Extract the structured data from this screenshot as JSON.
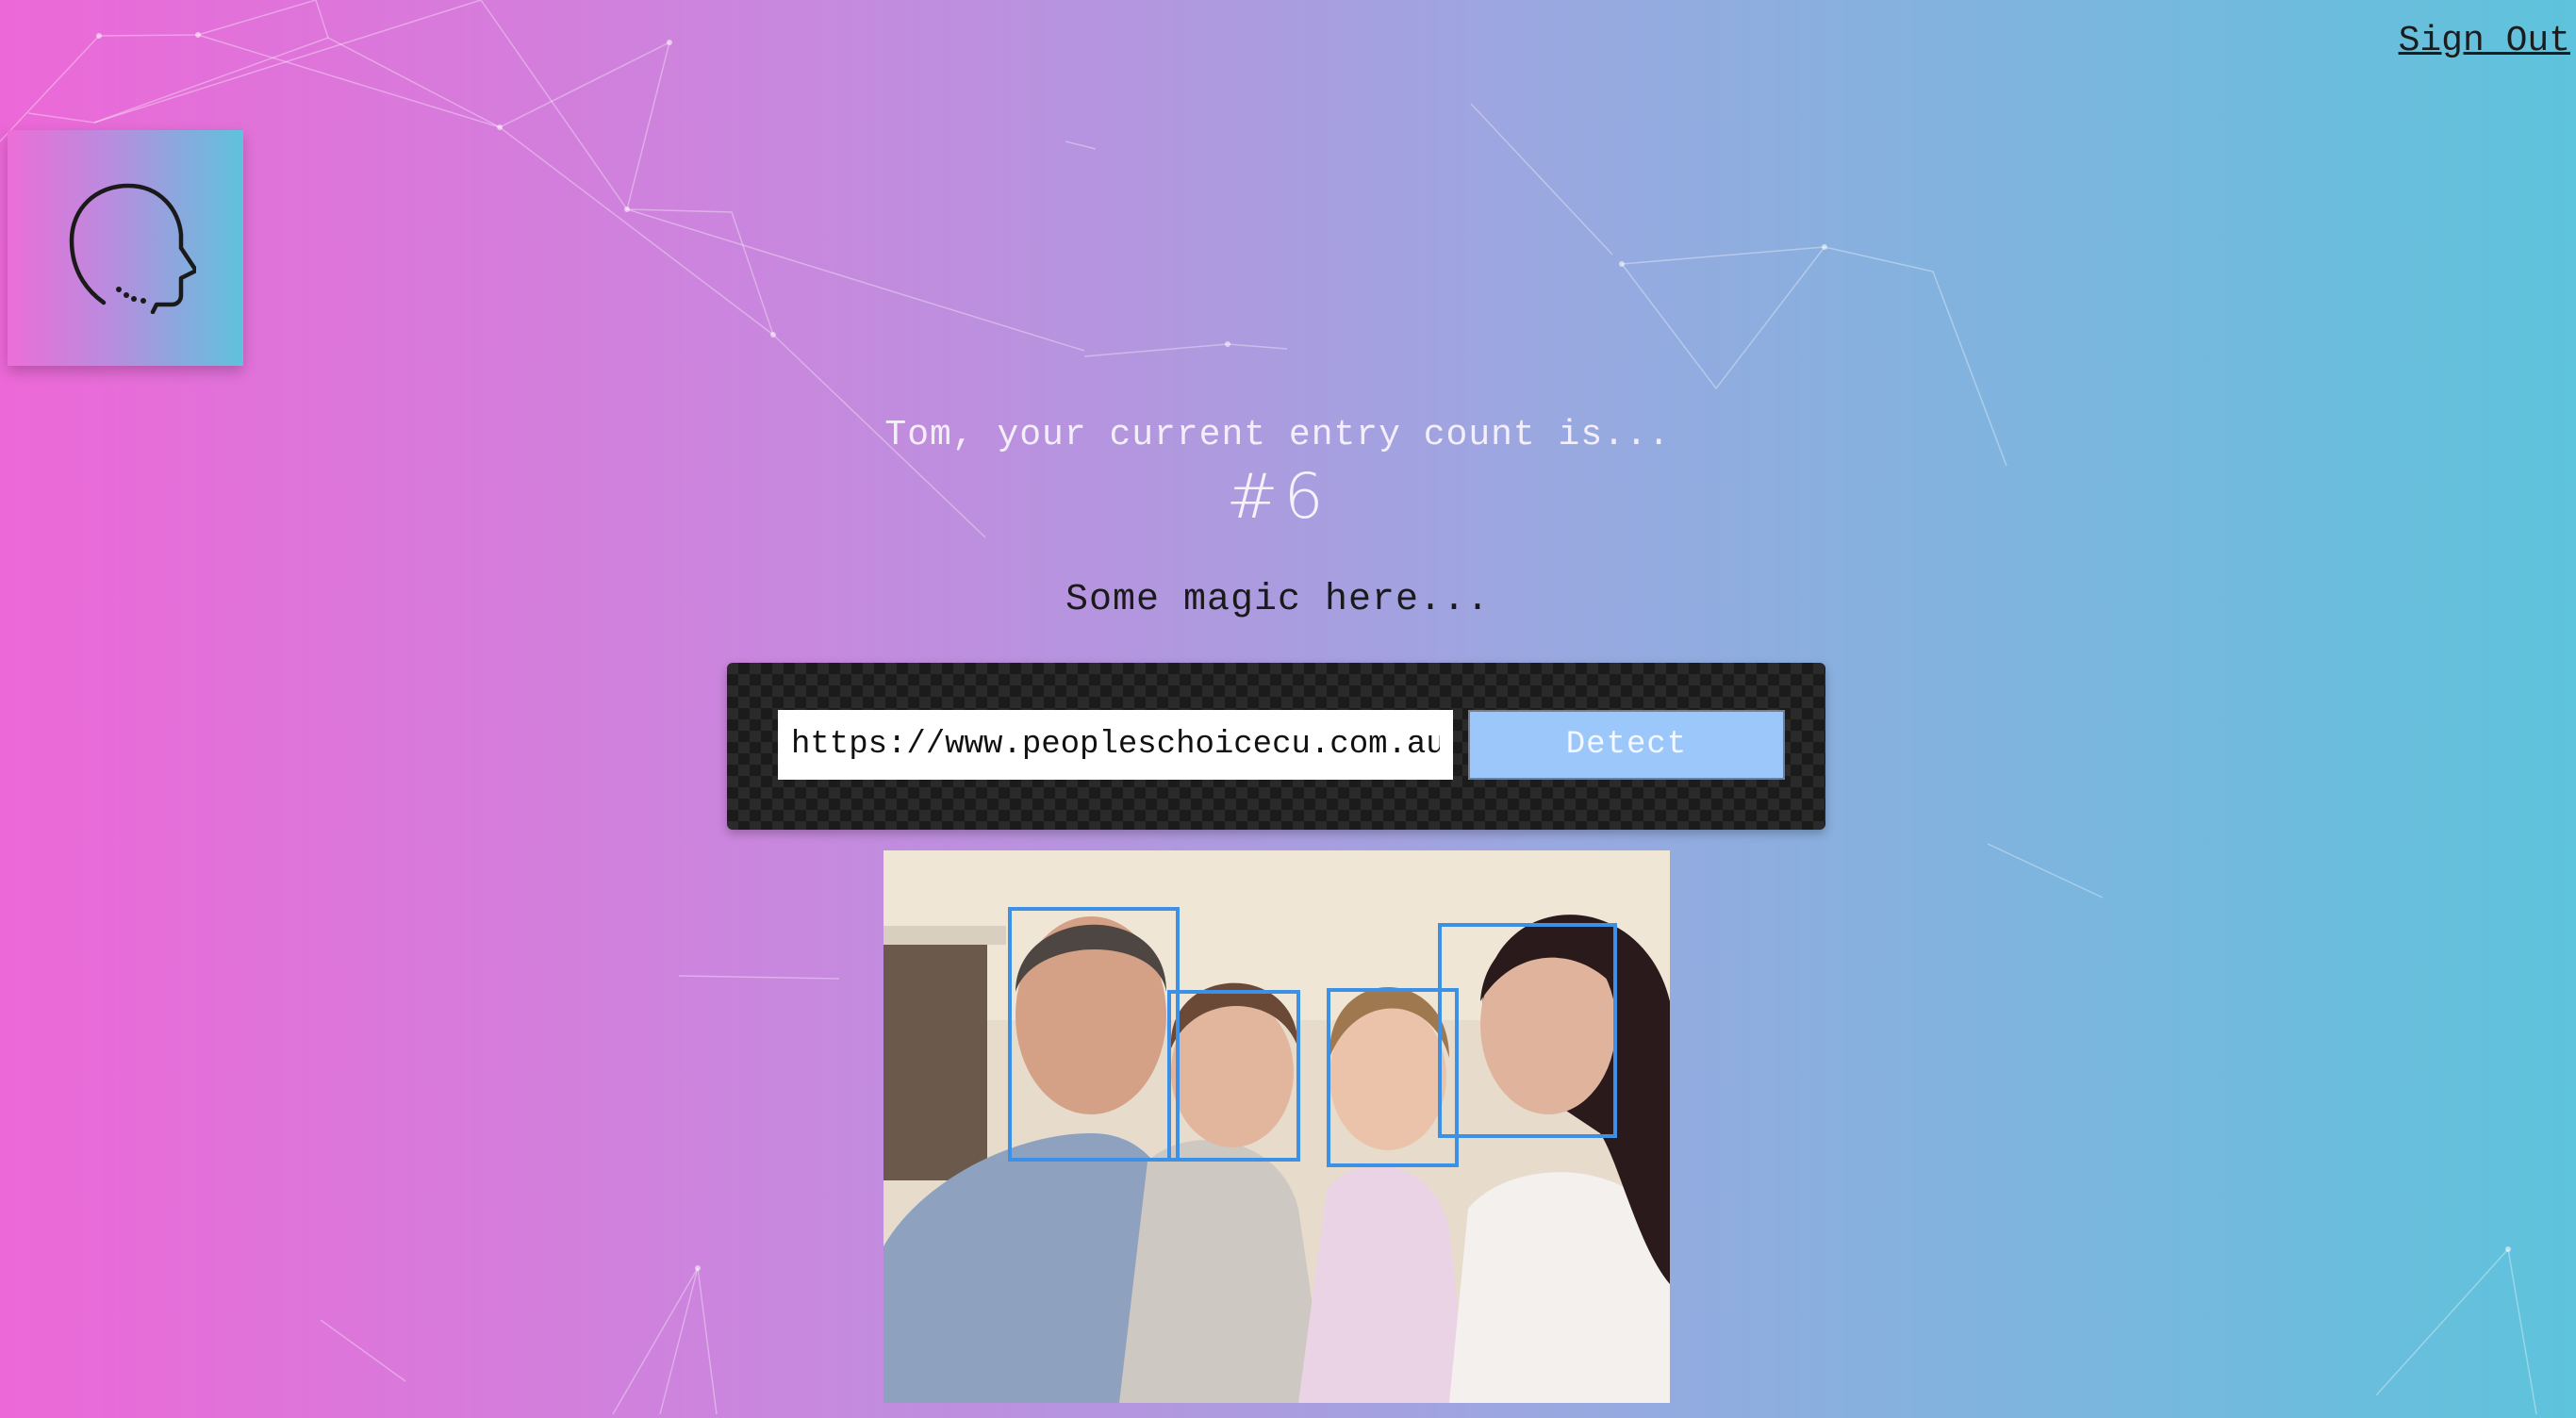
{
  "header": {
    "sign_out_label": "Sign Out"
  },
  "logo": {
    "icon": "head-profile-icon"
  },
  "main": {
    "greeting": "Tom, your current entry count is...",
    "entry_count": "#6",
    "subtitle": "Some magic here..."
  },
  "form": {
    "image_url": "https://www.peopleschoicecu.com.au/g",
    "detect_label": "Detect"
  },
  "result": {
    "faces_detected": 4
  },
  "colors": {
    "gradient_start": "#ec68d8",
    "gradient_end": "#5ec3dc",
    "face_box": "#3c90e6",
    "button": "#9cc7fa"
  }
}
